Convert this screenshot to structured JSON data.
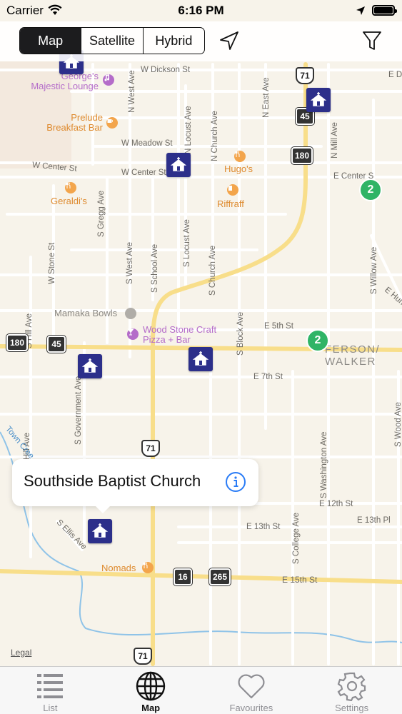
{
  "status_bar": {
    "carrier": "Carrier",
    "time": "6:16 PM"
  },
  "toolbar": {
    "segments": [
      "Map",
      "Satellite",
      "Hybrid"
    ],
    "active_segment": "Map"
  },
  "map": {
    "streets": {
      "w_dickson": "W Dickson St",
      "e_dickson": "E D",
      "w_meadow": "W Meadow St",
      "w_center_left": "W Center St",
      "w_center": "W Center St",
      "e_center": "E Center S",
      "n_west": "N West Ave",
      "n_locust": "N Locust Ave",
      "n_church": "N Church Ave",
      "n_east": "N East Ave",
      "n_mill": "N Mill Ave",
      "s_gregg": "S Gregg Ave",
      "w_stone": "W Stone St",
      "s_west": "S West Ave",
      "s_school": "S School Ave",
      "s_locust": "S Locust Ave",
      "s_church": "S Church Ave",
      "s_block": "S Block Ave",
      "s_willow": "S Willow Ave",
      "s_hill": "S Hill Ave",
      "s_hill_lower": "S Hill Ave",
      "e_5th": "E 5th St",
      "e_7th": "E 7th St",
      "e_hun": "E Hunt",
      "s_government": "S Government Ave",
      "s_washington": "S Washington Ave",
      "s_wood": "S Wood Ave",
      "e_12th": "E 12th St",
      "e_13th": "E 13th St",
      "e_13th_pl": "E 13th Pl",
      "s_college": "S College Ave",
      "s_ellis": "S Ellis Ave",
      "e_15th": "E 15th St",
      "town_creek": "Town Cree"
    },
    "pois": {
      "georges": "George's\nMajestic Lounge",
      "prelude": "Prelude\nBreakfast Bar",
      "hugos": "Hugo's",
      "riffraff": "Riffraff",
      "geraldis": "Geraldi's",
      "mamaka": "Mamaka Bowls",
      "woodstone": "Wood Stone Craft\nPizza + Bar",
      "nomads": "Nomads"
    },
    "district": "JEFFERSON/\nWALKER",
    "district_visible": "FERSON/\nWALKER",
    "clusters": [
      "2",
      "2"
    ],
    "shields": {
      "us71_top": "71",
      "r45_top": "45",
      "r180_top": "180",
      "r180_left": "180",
      "r45_left": "45",
      "us71_mid": "71",
      "r16": "16",
      "r265": "265",
      "us71_bottom": "71"
    },
    "legal": "Legal",
    "colors": {
      "land": "#f7f3ea",
      "road_minor": "#ffffff",
      "road_major": "#f8de8a",
      "church_pin": "#2c2f8a",
      "cluster": "#2fb466",
      "water": "#8fc3e8"
    }
  },
  "callout": {
    "title": "Southside Baptist Church"
  },
  "tabs": [
    {
      "label": "List",
      "icon": "list-icon"
    },
    {
      "label": "Map",
      "icon": "globe-icon"
    },
    {
      "label": "Favourites",
      "icon": "heart-icon"
    },
    {
      "label": "Settings",
      "icon": "gear-icon"
    }
  ],
  "active_tab": "Map"
}
